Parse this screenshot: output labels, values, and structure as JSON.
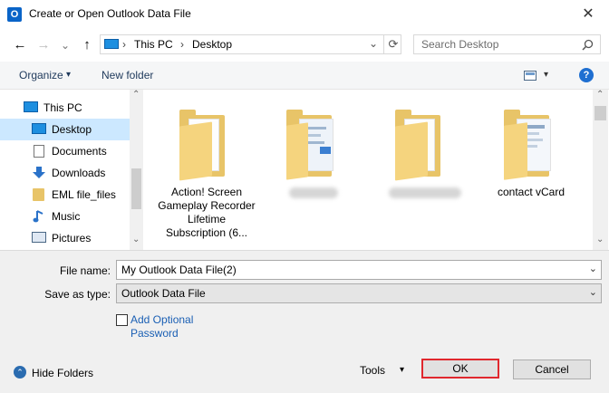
{
  "window": {
    "title": "Create or Open Outlook Data File",
    "app_icon_glyph": "O",
    "close_glyph": "✕"
  },
  "nav": {
    "back_glyph": "←",
    "forward_glyph": "→",
    "recent_glyph": "⌄",
    "up_glyph": "↑",
    "refresh_glyph": "⟳"
  },
  "address": {
    "segments": [
      "This PC",
      "Desktop"
    ],
    "separator": "›",
    "dropdown_glyph": "⌄"
  },
  "search": {
    "placeholder": "Search Desktop",
    "icon": "search-icon"
  },
  "toolbar": {
    "organize_label": "Organize",
    "organize_arrow": "▾",
    "new_folder_label": "New folder",
    "view_arrow": "▾",
    "help_glyph": "?"
  },
  "sidebar": {
    "items": [
      {
        "label": "This PC",
        "icon": "computer-icon"
      },
      {
        "label": "Desktop",
        "icon": "desktop-icon",
        "selected": true
      },
      {
        "label": "Documents",
        "icon": "documents-icon"
      },
      {
        "label": "Downloads",
        "icon": "downloads-icon"
      },
      {
        "label": "EML file_files",
        "icon": "folder-icon"
      },
      {
        "label": "Music",
        "icon": "music-icon"
      },
      {
        "label": "Pictures",
        "icon": "pictures-icon"
      }
    ],
    "scroll_up_glyph": "⌃",
    "scroll_down_glyph": "⌄"
  },
  "files": [
    {
      "label": "Action! Screen Gameplay Recorder Lifetime Subscription (6...",
      "type": "folder"
    },
    {
      "label": "",
      "type": "folder",
      "obscured": true
    },
    {
      "label": "",
      "type": "folder",
      "obscured": true
    },
    {
      "label": "contact vCard",
      "type": "folder"
    }
  ],
  "form": {
    "file_name_label": "File name:",
    "file_name_value": "My Outlook Data File(2)",
    "save_type_label": "Save as type:",
    "save_type_value": "Outlook Data File",
    "add_password_label": "Add Optional Password",
    "dropdown_glyph": "⌄"
  },
  "footer": {
    "hide_folders_label": "Hide Folders",
    "hide_folders_glyph": "⌃",
    "tools_label": "Tools",
    "tools_arrow": "▾",
    "ok_label": "OK",
    "cancel_label": "Cancel"
  },
  "colors": {
    "selection": "#cce8ff",
    "folder": "#e8c468",
    "highlight_border": "#e0282e",
    "link": "#1a5fb4"
  }
}
